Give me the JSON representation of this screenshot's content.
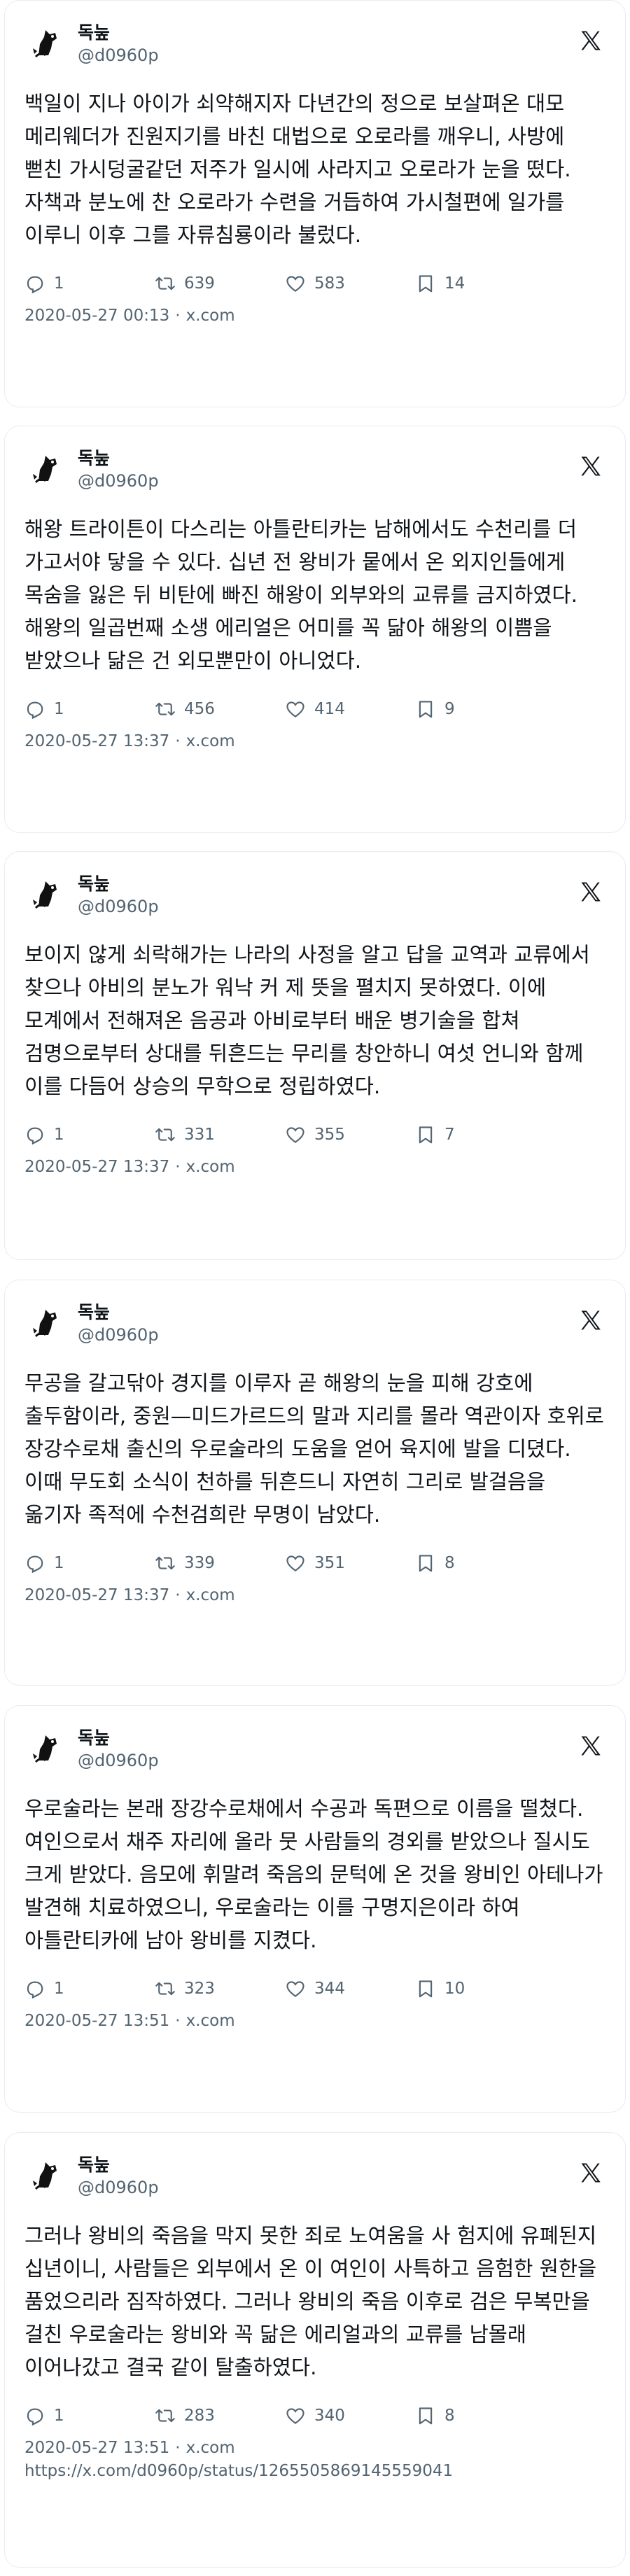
{
  "tweets": [
    {
      "display_name": "독눞",
      "handle": "@d0960p",
      "text": "백일이 지나 아이가 쇠약해지자 다년간의 정으로 보살펴온 대모 메리웨더가 진원지기를 바친 대법으로 오로라를 깨우니, 사방에 뻗친 가시덩굴같던 저주가 일시에 사라지고 오로라가 눈을 떴다. 자책과 분노에 찬 오로라가 수련을 거듭하여 가시철편에 일가를 이루니 이후 그를 자류침룡이라 불렀다.",
      "replies": "1",
      "retweets": "639",
      "likes": "583",
      "bookmarks": "14",
      "timestamp": "2020-05-27 00:13",
      "source": "x.com"
    },
    {
      "display_name": "독눞",
      "handle": "@d0960p",
      "text": "해왕 트라이튼이 다스리는 아틀란티카는 남해에서도 수천리를 더 가고서야 닿을 수 있다. 십년 전 왕비가 뭍에서 온 외지인들에게 목숨을 잃은 뒤 비탄에 빠진 해왕이 외부와의 교류를 금지하였다. 해왕의 일곱번째 소생 에리얼은 어미를 꼭 닮아 해왕의 이쁨을 받았으나 닮은 건 외모뿐만이 아니었다.",
      "replies": "1",
      "retweets": "456",
      "likes": "414",
      "bookmarks": "9",
      "timestamp": "2020-05-27 13:37",
      "source": "x.com"
    },
    {
      "display_name": "독눞",
      "handle": "@d0960p",
      "text": "보이지 않게 쇠락해가는 나라의 사정을 알고 답을 교역과 교류에서 찾으나 아비의 분노가 워낙 커 제 뜻을 펼치지 못하였다. 이에 모계에서 전해져온 음공과 아비로부터 배운 병기술을 합쳐 검명으로부터 상대를 뒤흔드는 무리를 창안하니 여섯 언니와 함께 이를 다듬어 상승의 무학으로 정립하였다.",
      "replies": "1",
      "retweets": "331",
      "likes": "355",
      "bookmarks": "7",
      "timestamp": "2020-05-27 13:37",
      "source": "x.com"
    },
    {
      "display_name": "독눞",
      "handle": "@d0960p",
      "text": "무공을 갈고닦아 경지를 이루자 곧 해왕의 눈을 피해 강호에 출두함이라, 중원—미드가르드의 말과 지리를 몰라 역관이자 호위로 장강수로채 출신의 우로술라의 도움을 얻어 육지에 발을 디뎠다. 이때 무도회 소식이 천하를 뒤흔드니 자연히 그리로 발걸음을 옮기자 족적에 수천검희란 무명이 남았다.",
      "replies": "1",
      "retweets": "339",
      "likes": "351",
      "bookmarks": "8",
      "timestamp": "2020-05-27 13:37",
      "source": "x.com"
    },
    {
      "display_name": "독눞",
      "handle": "@d0960p",
      "text": "우로술라는 본래 장강수로채에서 수공과 독편으로 이름을 떨쳤다. 여인으로서 채주 자리에 올라 뭇 사람들의 경외를 받았으나 질시도 크게 받았다. 음모에 휘말려 죽음의 문턱에 온 것을 왕비인 아테나가 발견해 치료하였으니, 우로술라는 이를 구명지은이라 하여 아틀란티카에 남아 왕비를 지켰다.",
      "replies": "1",
      "retweets": "323",
      "likes": "344",
      "bookmarks": "10",
      "timestamp": "2020-05-27 13:51",
      "source": "x.com"
    },
    {
      "display_name": "독눞",
      "handle": "@d0960p",
      "text": "그러나 왕비의 죽음을 막지 못한 죄로 노여움을 사 험지에 유폐된지 십년이니, 사람들은 외부에서 온 이 여인이 사특하고 음험한 원한을 품었으리라 짐작하였다. 그러나 왕비의 죽음 이후로 검은 무복만을 걸친 우로술라는 왕비와 꼭 닮은 에리얼과의 교류를 남몰래 이어나갔고 결국 같이 탈출하였다.",
      "replies": "1",
      "retweets": "283",
      "likes": "340",
      "bookmarks": "8",
      "timestamp": "2020-05-27 13:51",
      "source": "x.com",
      "url": "https://x.com/d0960p/status/1265505869145559041"
    }
  ],
  "icons": {
    "brand": "x-logo-icon",
    "reply": "reply-icon",
    "retweet": "retweet-icon",
    "like": "heart-icon",
    "bookmark": "bookmark-icon",
    "avatar": "avatar-icon"
  }
}
